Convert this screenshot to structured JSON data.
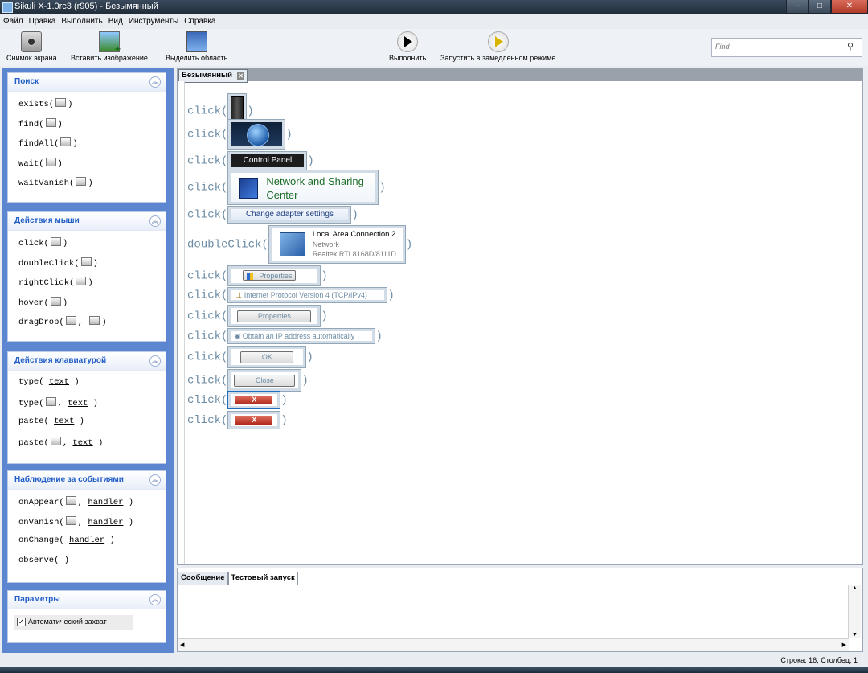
{
  "window": {
    "title": "Sikuli X-1.0rc3 (r905) - Безымянный"
  },
  "menu": [
    "Файл",
    "Правка",
    "Выполнить",
    "Вид",
    "Инструменты",
    "Справка"
  ],
  "toolbar": {
    "screenshot": "Снимок экрана",
    "insert_image": "Вставить изображение",
    "select_area": "Выделить область",
    "run": "Выполнить",
    "run_slow": "Запустить в замедленном режиме",
    "search_placeholder": "Find"
  },
  "sidebar": {
    "groups": [
      {
        "title": "Поиск",
        "commands": [
          "exists(",
          "find(",
          "findAll(",
          "wait(",
          "waitVanish("
        ]
      },
      {
        "title": "Действия мыши",
        "commands": [
          "click(",
          "doubleClick(",
          "rightClick(",
          "hover(",
          "dragDrop("
        ]
      },
      {
        "title": "Действия клавиатурой",
        "commands": [
          "type(",
          "type(",
          "paste(",
          "paste("
        ]
      },
      {
        "title": "Наблюдение за событиями",
        "commands": [
          "onAppear(",
          "onVanish(",
          "onChange(",
          "observe("
        ]
      },
      {
        "title": "Параметры"
      }
    ],
    "arg_text": "text",
    "arg_handler": "handler",
    "auto_capture": "Автоматический захват"
  },
  "editor": {
    "tab": "Безымянный",
    "lines": [
      {
        "fn": "click(",
        "caption": ""
      },
      {
        "fn": "click(",
        "caption": ""
      },
      {
        "fn": "click(",
        "caption": "Control Panel"
      },
      {
        "fn": "click(",
        "caption": "Network and Sharing Center"
      },
      {
        "fn": "click(",
        "caption": "Change adapter settings"
      },
      {
        "fn": "doubleClick(",
        "caption": "Local Area Connection 2"
      },
      {
        "fn": "click(",
        "caption": "Properties"
      },
      {
        "fn": "click(",
        "caption": "Internet Protocol Version 4 (TCP/IPv4)"
      },
      {
        "fn": "click(",
        "caption": "Properties"
      },
      {
        "fn": "click(",
        "caption": "Obtain an IP address automatically"
      },
      {
        "fn": "click(",
        "caption": "OK"
      },
      {
        "fn": "click(",
        "caption": "Close"
      },
      {
        "fn": "click(",
        "caption": "X"
      },
      {
        "fn": "click(",
        "caption": "X"
      }
    ],
    "nsc_line1": "Network and Sharing",
    "nsc_line2": "Center",
    "lac_title": "Local Area Connection 2",
    "lac_sub1": "Network",
    "lac_sub2": "Realtek RTL8168D/8111D"
  },
  "console": {
    "tabs": [
      "Сообщение",
      "Тестовый запуск"
    ]
  },
  "status": {
    "position": "Строка: 16, Столбец: 1"
  }
}
